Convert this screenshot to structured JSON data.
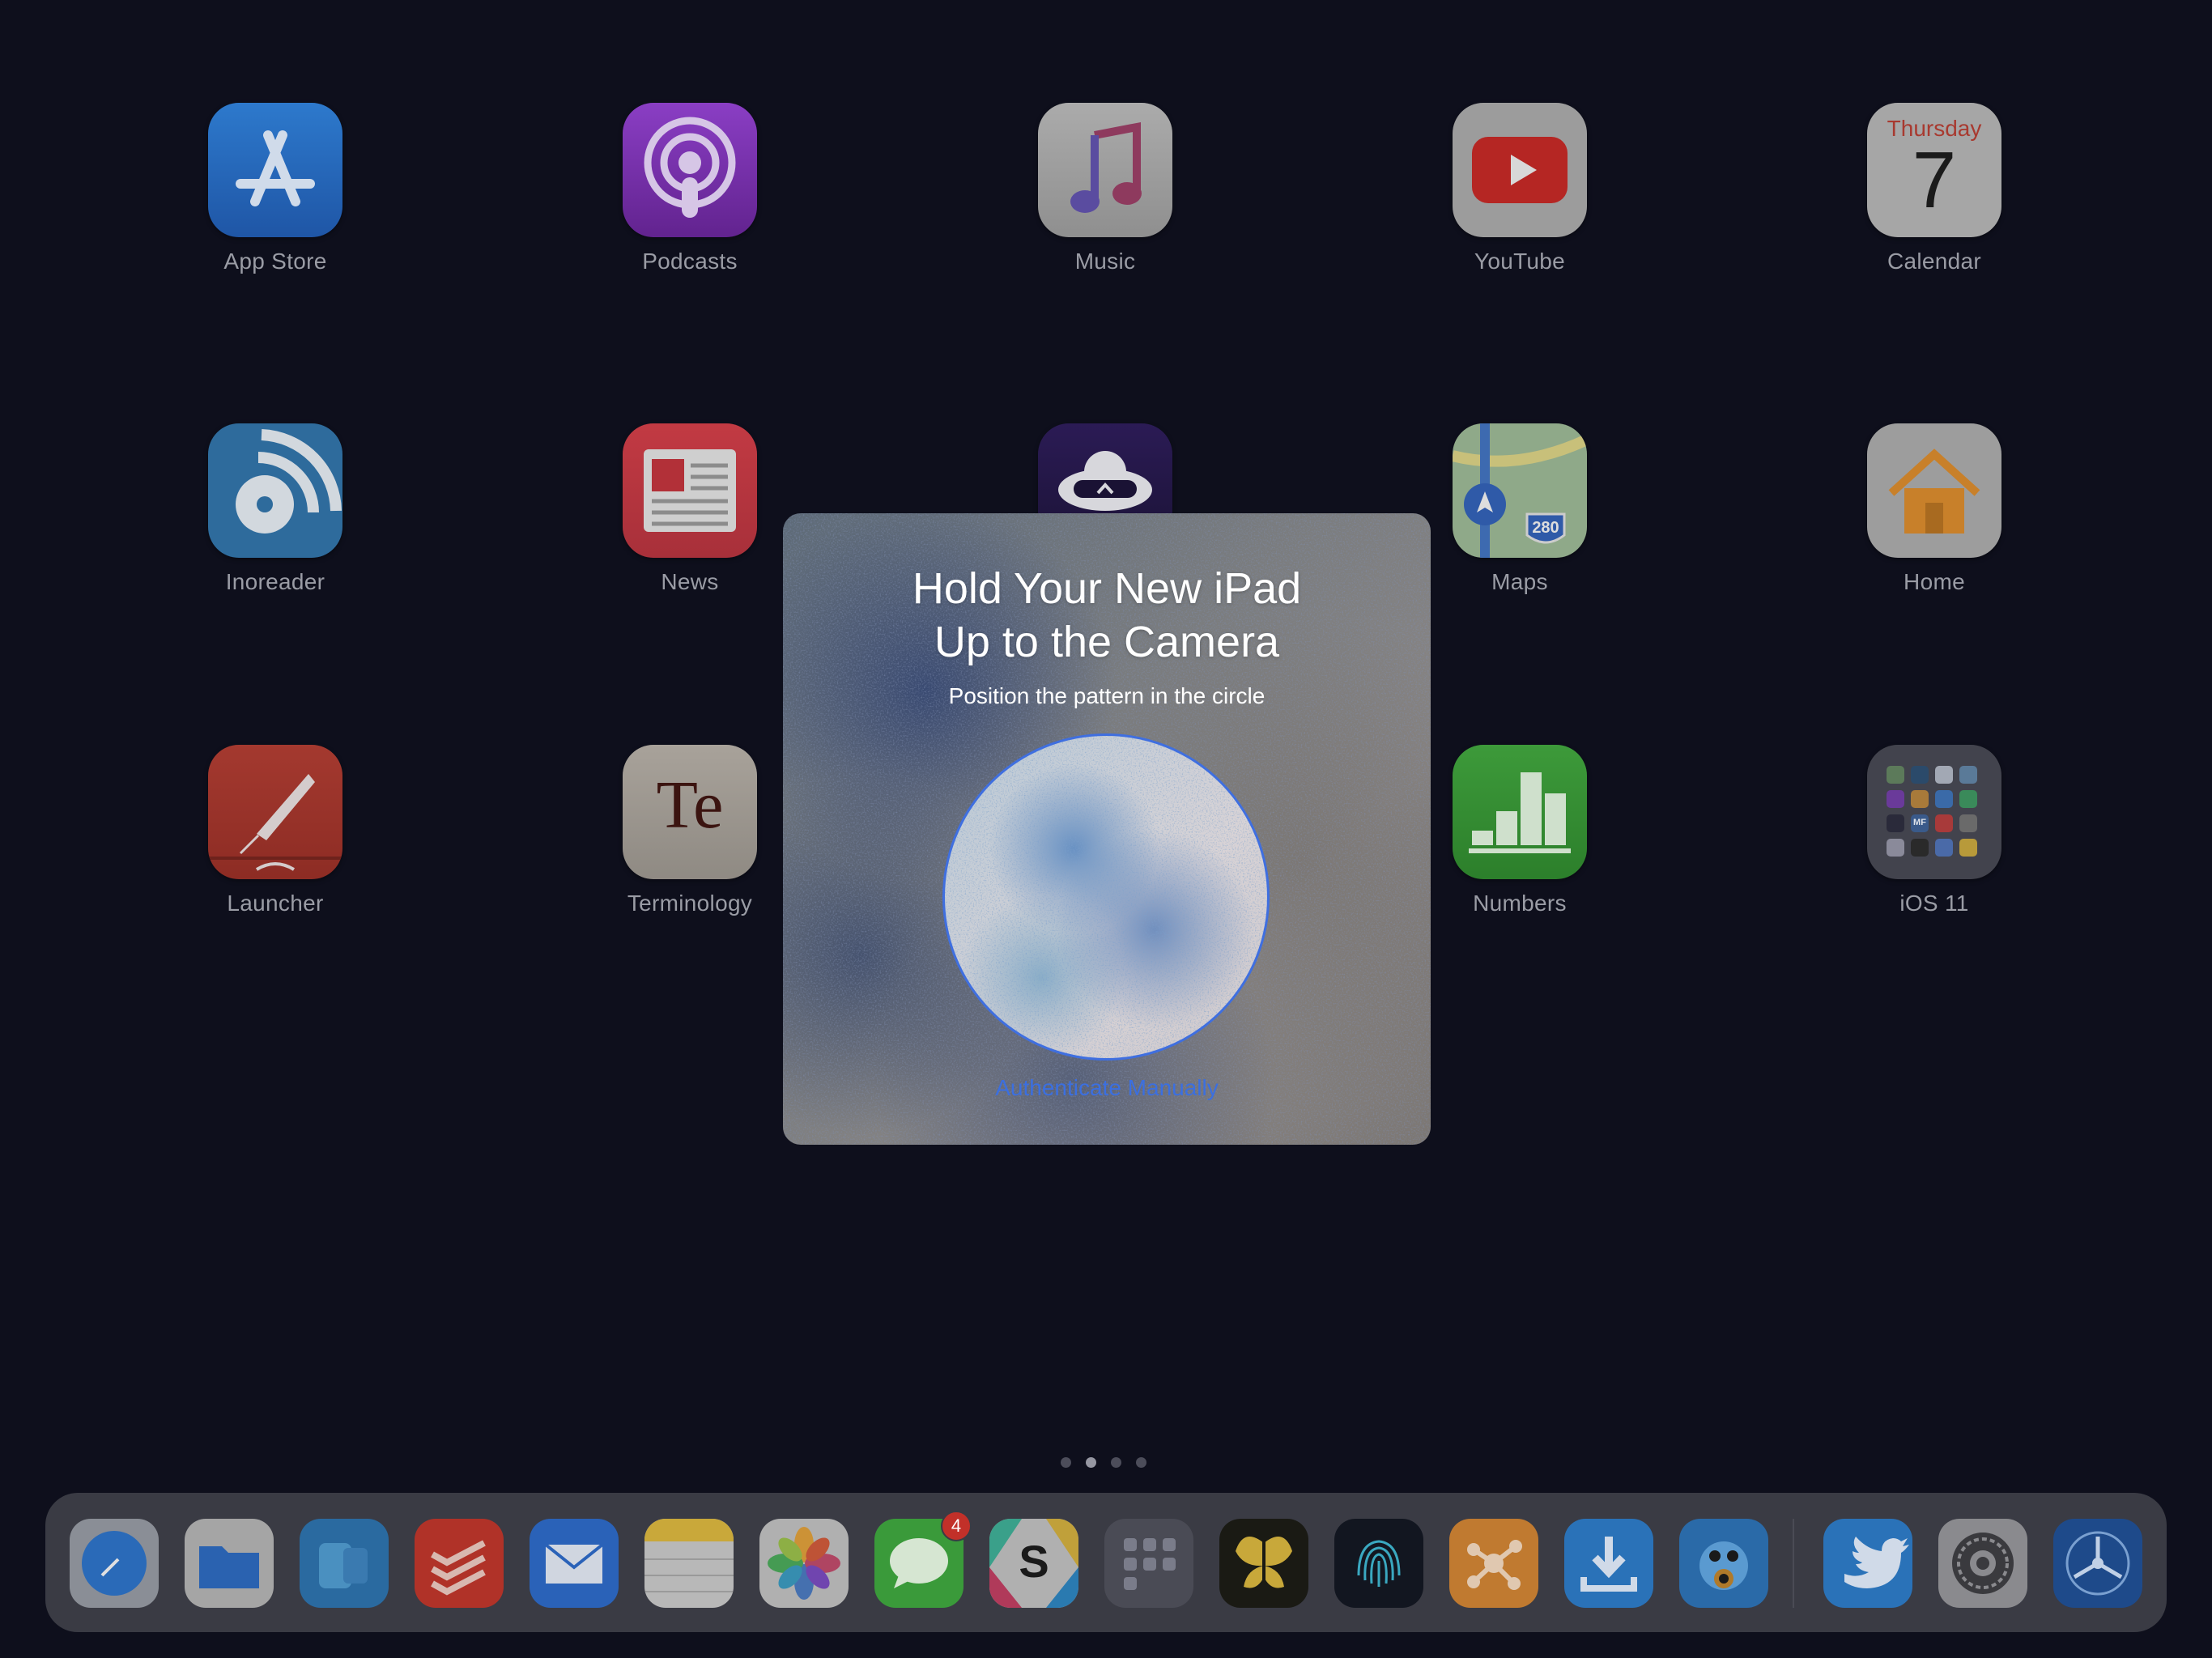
{
  "apps": [
    {
      "id": "app-store",
      "label": "App Store"
    },
    {
      "id": "podcasts",
      "label": "Podcasts"
    },
    {
      "id": "music",
      "label": "Music"
    },
    {
      "id": "youtube",
      "label": "YouTube"
    },
    {
      "id": "calendar",
      "label": "Calendar",
      "day_name": "Thursday",
      "day_number": "7"
    },
    {
      "id": "inoreader",
      "label": "Inoreader"
    },
    {
      "id": "news",
      "label": "News"
    },
    {
      "id": "maps",
      "label": "Maps",
      "shield": "280"
    },
    {
      "id": "home",
      "label": "Home"
    },
    {
      "id": "launcher",
      "label": "Launcher"
    },
    {
      "id": "terminology",
      "label": "Terminology",
      "glyph": "Te"
    },
    {
      "id": "numbers",
      "label": "Numbers"
    },
    {
      "id": "ios11",
      "label": "iOS 11",
      "mini_labels": [
        "MF"
      ]
    }
  ],
  "modal": {
    "title_line1": "Hold Your New iPad",
    "title_line2": "Up to the Camera",
    "subtitle": "Position the pattern in the circle",
    "link": "Authenticate Manually",
    "accent": "#3b6fe0"
  },
  "page_indicator": {
    "count": 4,
    "active": 1
  },
  "dock": {
    "icons": [
      "safari-icon",
      "files-icon",
      "app-folder-icon",
      "todoist-icon",
      "mail-icon",
      "notes-icon",
      "photos-icon",
      "messages-icon",
      "slack-icon",
      "folder-icon",
      "tes-icon",
      "fingerprint-icon",
      "mindnode-icon",
      "downloads-icon",
      "tweetbot-icon",
      "twitter-icon",
      "settings-icon",
      "testflight-icon"
    ],
    "messages_badge": "4"
  }
}
